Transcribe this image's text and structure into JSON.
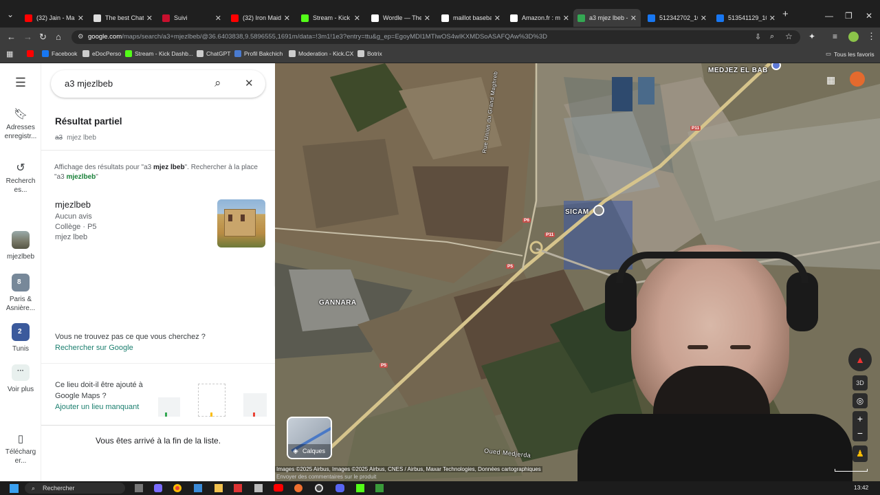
{
  "browser": {
    "tabs": [
      {
        "label": "(32) Jain - Mak",
        "color": "#ff0000"
      },
      {
        "label": "The best ChatG",
        "color": "#dddddd"
      },
      {
        "label": "Suivi",
        "color": "#c8102e"
      },
      {
        "label": "(32) Iron Maide",
        "color": "#ff0000"
      },
      {
        "label": "Stream - Kick D",
        "color": "#53fc18"
      },
      {
        "label": "Wordle — The",
        "color": "#ffffff"
      },
      {
        "label": "maillot baseba",
        "color": "#ffffff"
      },
      {
        "label": "Amazon.fr : ma",
        "color": "#ffffff"
      },
      {
        "label": "a3 mjez lbeb -",
        "color": "#34a853"
      },
      {
        "label": "512342702_10",
        "color": "#1877f2"
      },
      {
        "label": "513541129_10",
        "color": "#1877f2"
      }
    ],
    "new_tab": "+",
    "url_domain": "google.com",
    "url_rest": "/maps/search/a3+mjezlbeb/@36.6403838,9.5896555,1691m/data=!3m1!1e3?entry=ttu&g_ep=EgoyMDI1MTIwOS4wIKXMDSoASAFQAw%3D%3D",
    "bookmarks": [
      {
        "label": "",
        "color": "#ff0000"
      },
      {
        "label": "Facebook",
        "color": "#1877f2"
      },
      {
        "label": "eDocPerso",
        "color": "#cccccc"
      },
      {
        "label": "Stream - Kick Dashb...",
        "color": "#53fc18"
      },
      {
        "label": "ChatGPT",
        "color": "#cccccc"
      },
      {
        "label": "Profil Bakchich",
        "color": "#4a7bd0"
      },
      {
        "label": "Moderation - Kick.CX",
        "color": "#cccccc"
      },
      {
        "label": "Botrix",
        "color": "#cccccc"
      }
    ],
    "all_bookmarks": "Tous les favoris"
  },
  "rail": {
    "saved": "Adresses enregistr...",
    "recent": "Recherch es...",
    "items": [
      {
        "label": "mjezlbeb",
        "badge": ""
      },
      {
        "label": "Paris & Asnière...",
        "badge": "8"
      },
      {
        "label": "Tunis",
        "badge": "2"
      }
    ],
    "more": "Voir plus",
    "download": "Télécharg er..."
  },
  "panel": {
    "search_value": "a3 mjezlbeb",
    "partial_title": "Résultat partiel",
    "partial_strike": "a3",
    "partial_rest": "mjez lbeb",
    "showing_prefix": "Affichage des résultats pour \"a3 ",
    "showing_bold": "mjez lbeb",
    "showing_mid": "\". Rechercher à la place \"a3 ",
    "showing_link": "mjezlbeb",
    "showing_end": "\"",
    "result": {
      "name": "mjezlbeb",
      "reviews": "Aucun avis",
      "category": "Collège · P5",
      "address": "mjez lbeb"
    },
    "not_found_q": "Vous ne trouvez pas ce que vous cherchez ?",
    "search_google": "Rechercher sur Google",
    "add_q1": "Ce lieu doit-il être ajouté à",
    "add_q2": "Google Maps ?",
    "add_link": "Ajouter un lieu manquant",
    "end": "Vous êtes arrivé à la fin de la liste."
  },
  "map": {
    "labels": {
      "medjez": "MEDJEZ EL BAB",
      "sicam": "SICAM",
      "gannara": "GANNARA",
      "road": "Rue Union du Grand Maghreb",
      "oued": "Oued Medjerda"
    },
    "roads": [
      "P11",
      "P11",
      "P6",
      "P5",
      "P5"
    ],
    "layers": "Calques",
    "attribution": "Images ©2025 Airbus, Images ©2025 Airbus, CNES / Airbus, Maxar Technologies, Données cartographiques",
    "feedback": "Envoyer des commentaires sur le produit",
    "btn_3d": "3D"
  },
  "taskbar": {
    "search": "Rechercher",
    "time": "13:42"
  }
}
